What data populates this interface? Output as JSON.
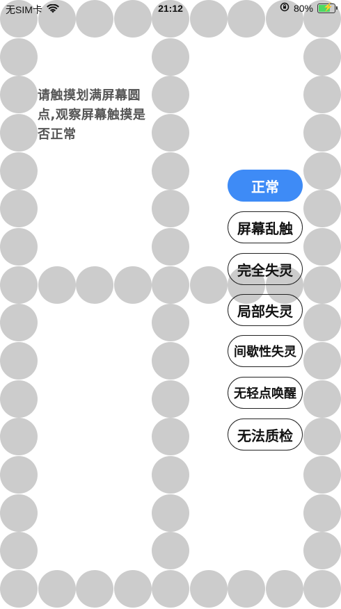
{
  "status_bar": {
    "carrier": "无SIM卡",
    "time": "21:12",
    "battery_percent": "80%",
    "battery_level": 0.8,
    "colors": {
      "battery_fill": "#4cd964"
    },
    "icons": [
      "wifi-icon",
      "orientation-lock-icon",
      "battery-charging-icon"
    ]
  },
  "instruction": "请触摸划满屏幕圆点,观察屏幕触摸是否正常",
  "buttons": [
    {
      "label": "正常",
      "active": true
    },
    {
      "label": "屏幕乱触",
      "active": false
    },
    {
      "label": "完全失灵",
      "active": false
    },
    {
      "label": "局部失灵",
      "active": false
    },
    {
      "label": "间歇性失灵",
      "active": false
    },
    {
      "label": "无轻点唤醒",
      "active": false
    },
    {
      "label": "无法质检",
      "active": false
    }
  ],
  "colors": {
    "dot": "#cccccc",
    "active_button": "#3e8bf6"
  }
}
